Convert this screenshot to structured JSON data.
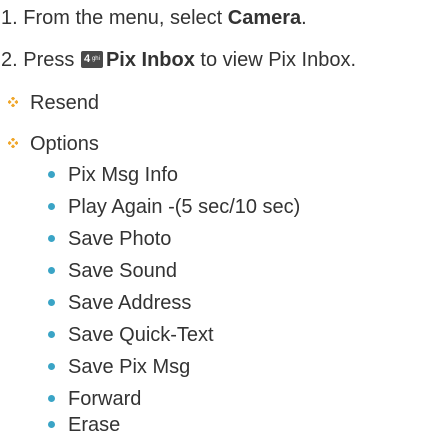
{
  "colors": {
    "text": "#333333",
    "bullet": "#3aa4c6",
    "diamond": "#f0a62a",
    "key_icon_bg": "#4a4a4a"
  },
  "steps": [
    {
      "number": "1.",
      "text_before": "From the menu, select ",
      "bold": "Camera",
      "text_after": "."
    },
    {
      "number": "2.",
      "text_before": "Press ",
      "key_icon": "camera-key-icon",
      "key_label_main": "4",
      "key_label_sub": "ghi",
      "bold": "Pix Inbox",
      "text_after": " to view Pix Inbox."
    }
  ],
  "sections": [
    {
      "label": "Resend",
      "icon": "orange-diamond-icon"
    },
    {
      "label": "Options",
      "icon": "orange-diamond-icon"
    }
  ],
  "options": [
    "Pix Msg Info",
    "Play Again -(5 sec/10 sec)",
    "Save Photo",
    "Save Sound",
    "Save Address",
    "Save Quick-Text",
    "Save Pix Msg",
    "Forward",
    "Erase"
  ]
}
